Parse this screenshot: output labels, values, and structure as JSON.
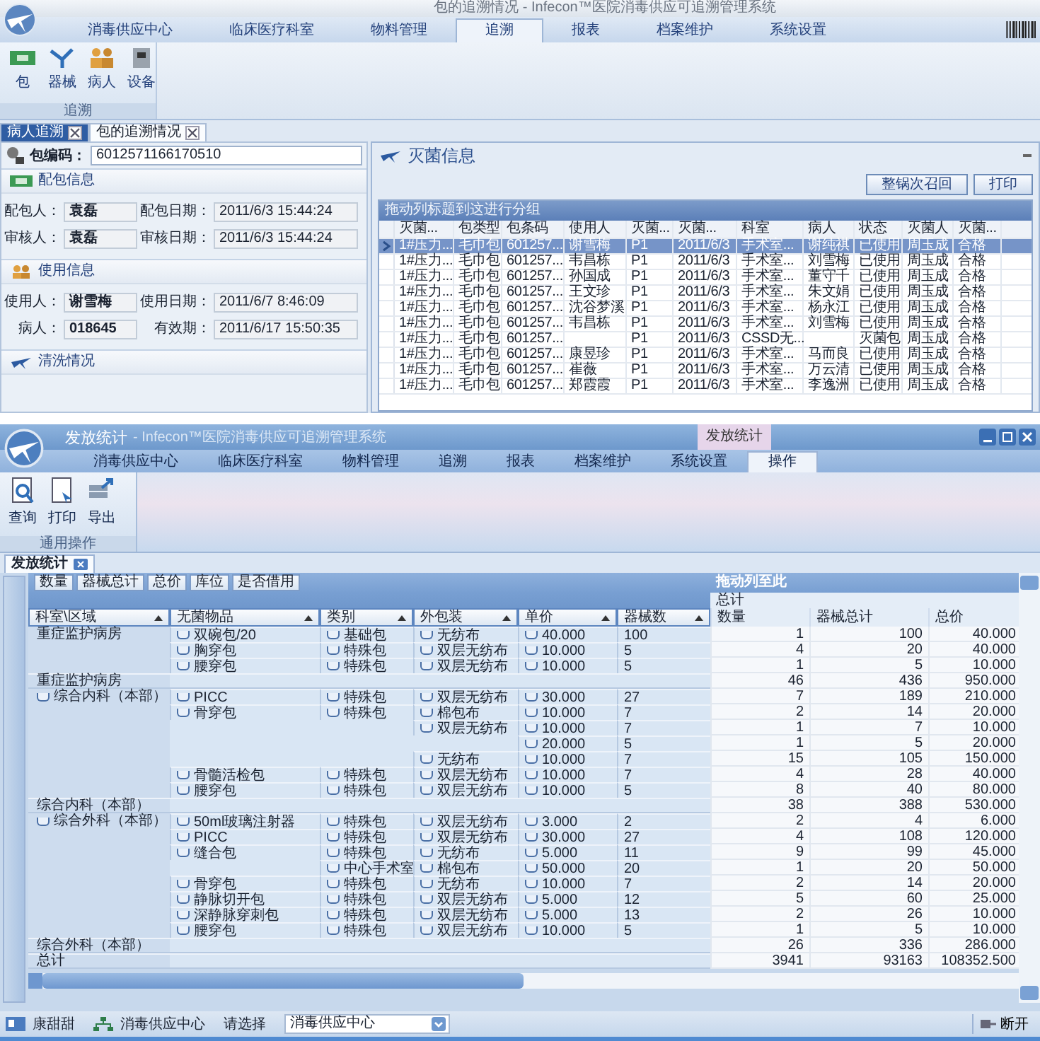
{
  "top_window": {
    "title": "包的追溯情况 - Infecon™医院消毒供应可追溯管理系统",
    "menu": [
      {
        "label": "消毒供应中心",
        "selected": false
      },
      {
        "label": "临床医疗科室",
        "selected": false
      },
      {
        "label": "物料管理",
        "selected": false
      },
      {
        "label": "追溯",
        "selected": true
      },
      {
        "label": "报表",
        "selected": false
      },
      {
        "label": "档案维护",
        "selected": false
      },
      {
        "label": "系统设置",
        "selected": false
      }
    ],
    "ribbon": {
      "buttons": [
        "包",
        "器械",
        "病人",
        "设备"
      ],
      "group": "追溯"
    },
    "doc_tabs": [
      {
        "label": "病人追溯",
        "selected": false,
        "hover": true
      },
      {
        "label": "包的追溯情况",
        "selected": true,
        "hover": false
      }
    ],
    "trace": {
      "code_label": "包编码：",
      "code": "6012571166170510",
      "sections": [
        {
          "title": "配包信息",
          "fields": [
            {
              "label": "配包人：",
              "value": "袁磊"
            },
            {
              "label": "配包日期：",
              "value": "2011/6/3 15:44:24"
            },
            {
              "label": "审核人：",
              "value": "袁磊"
            },
            {
              "label": "审核日期：",
              "value": "2011/6/3 15:44:24"
            }
          ]
        },
        {
          "title": "使用信息",
          "fields": [
            {
              "label": "使用人：",
              "value": "谢雪梅"
            },
            {
              "label": "使用日期：",
              "value": "2011/6/7 8:46:09"
            },
            {
              "label": "病人：",
              "value": "018645"
            },
            {
              "label": "有效期：",
              "value": "2011/6/17 15:50:35"
            }
          ]
        },
        {
          "title": "清洗情况"
        }
      ]
    },
    "sterilization": {
      "title": "灭菌信息",
      "buttons": [
        "整锅次召回",
        "打印"
      ],
      "group_hint": "拖动列标题到这进行分组",
      "columns": [
        "灭菌...",
        "包类型",
        "包条码",
        "使用人",
        "灭菌...",
        "灭菌...",
        "科室",
        "病人",
        "状态",
        "灭菌人",
        "灭菌..."
      ],
      "rows": [
        {
          "selected": true,
          "cells": [
            "1#压力...",
            "毛巾包",
            "601257...",
            "谢雪梅",
            "P1",
            "2011/6/3",
            "手术室...",
            "谢纯祺",
            "已使用",
            "周玉成",
            "合格"
          ]
        },
        {
          "selected": false,
          "cells": [
            "1#压力...",
            "毛巾包",
            "601257...",
            "韦昌栋",
            "P1",
            "2011/6/3",
            "手术室...",
            "刘雪梅",
            "已使用",
            "周玉成",
            "合格"
          ]
        },
        {
          "selected": false,
          "cells": [
            "1#压力...",
            "毛巾包",
            "601257...",
            "孙国成",
            "P1",
            "2011/6/3",
            "手术室...",
            "董守千",
            "已使用",
            "周玉成",
            "合格"
          ]
        },
        {
          "selected": false,
          "cells": [
            "1#压力...",
            "毛巾包",
            "601257...",
            "王文珍",
            "P1",
            "2011/6/3",
            "手术室...",
            "朱文娟",
            "已使用",
            "周玉成",
            "合格"
          ]
        },
        {
          "selected": false,
          "cells": [
            "1#压力...",
            "毛巾包",
            "601257...",
            "沈谷梦溪",
            "P1",
            "2011/6/3",
            "手术室...",
            "杨永江",
            "已使用",
            "周玉成",
            "合格"
          ]
        },
        {
          "selected": false,
          "cells": [
            "1#压力...",
            "毛巾包",
            "601257...",
            "韦昌栋",
            "P1",
            "2011/6/3",
            "手术室...",
            "刘雪梅",
            "已使用",
            "周玉成",
            "合格"
          ]
        },
        {
          "selected": false,
          "cells": [
            "1#压力...",
            "毛巾包",
            "601257...",
            null,
            "P1",
            "2011/6/3",
            "CSSD无...",
            null,
            "灭菌包",
            "周玉成",
            "合格"
          ]
        },
        {
          "selected": false,
          "cells": [
            "1#压力...",
            "毛巾包",
            "601257...",
            "康昱珍",
            "P1",
            "2011/6/3",
            "手术室...",
            "马而良",
            "已使用",
            "周玉成",
            "合格"
          ]
        },
        {
          "selected": false,
          "cells": [
            "1#压力...",
            "毛巾包",
            "601257...",
            "崔薇",
            "P1",
            "2011/6/3",
            "手术室...",
            "万云清",
            "已使用",
            "周玉成",
            "合格"
          ]
        },
        {
          "selected": false,
          "cells": [
            "1#压力...",
            "毛巾包",
            "601257...",
            "郑霞霞",
            "P1",
            "2011/6/3",
            "手术室...",
            "李逸洲",
            "已使用",
            "周玉成",
            "合格"
          ]
        }
      ]
    }
  },
  "bottom_window": {
    "title_doc": "发放统计",
    "title_app": "- Infecon™医院消毒供应可追溯管理系统",
    "context_tab": "发放统计",
    "menu": [
      {
        "label": "消毒供应中心",
        "selected": false
      },
      {
        "label": "临床医疗科室",
        "selected": false
      },
      {
        "label": "物料管理",
        "selected": false
      },
      {
        "label": "追溯",
        "selected": false
      },
      {
        "label": "报表",
        "selected": false
      },
      {
        "label": "档案维护",
        "selected": false
      },
      {
        "label": "系统设置",
        "selected": false
      },
      {
        "label": "操作",
        "selected": true
      }
    ],
    "ribbon": {
      "buttons": [
        "查询",
        "打印",
        "导出"
      ],
      "group": "通用操作"
    },
    "doc_tabs": [
      {
        "label": "发放统计",
        "selected": true
      }
    ],
    "pivot": {
      "filter_fields": [
        "数量",
        "器械总计",
        "总价",
        "库位",
        "是否借用"
      ],
      "drop_hint": "拖动列至此",
      "row_fields": [
        "科室\\区域",
        "无菌物品",
        "类别",
        "外包装",
        "单价",
        "器械数"
      ],
      "data_header": "总计",
      "data_fields": [
        "数量",
        "器械总计",
        "总价"
      ],
      "rows": [
        {
          "kind": "data",
          "area": "重症监护病房",
          "item": "双碗包/20",
          "category": "基础包",
          "pack": "无纺布",
          "price": "40.000",
          "count": "100",
          "values": [
            "1",
            "100",
            "40.000"
          ]
        },
        {
          "kind": "data",
          "item": "胸穿包",
          "category": "特殊包",
          "pack": "双层无纺布",
          "price": "10.000",
          "count": "5",
          "values": [
            "4",
            "20",
            "40.000"
          ]
        },
        {
          "kind": "data",
          "item": "腰穿包",
          "category": "特殊包",
          "pack": "双层无纺布",
          "price": "10.000",
          "count": "5",
          "values": [
            "1",
            "5",
            "10.000"
          ]
        },
        {
          "kind": "subtotal",
          "area": "重症监护病房",
          "values": [
            "46",
            "436",
            "950.000"
          ]
        },
        {
          "kind": "data",
          "area": "综合内科（本部）",
          "area_expanded": true,
          "item": "PICC",
          "category": "特殊包",
          "pack": "双层无纺布",
          "price": "30.000",
          "count": "27",
          "values": [
            "7",
            "189",
            "210.000"
          ]
        },
        {
          "kind": "data",
          "item": "骨穿包",
          "category": "特殊包",
          "pack": "棉包布",
          "price": "10.000",
          "count": "7",
          "values": [
            "2",
            "14",
            "20.000"
          ]
        },
        {
          "kind": "data",
          "pack": "双层无纺布",
          "price": "10.000",
          "count": "7",
          "values": [
            "1",
            "7",
            "10.000"
          ]
        },
        {
          "kind": "data",
          "price": "20.000",
          "count": "5",
          "values": [
            "1",
            "5",
            "20.000"
          ]
        },
        {
          "kind": "data",
          "pack": "无纺布",
          "price": "10.000",
          "count": "7",
          "values": [
            "15",
            "105",
            "150.000"
          ]
        },
        {
          "kind": "data",
          "item": "骨髓活检包",
          "category": "特殊包",
          "pack": "双层无纺布",
          "price": "10.000",
          "count": "7",
          "values": [
            "4",
            "28",
            "40.000"
          ]
        },
        {
          "kind": "data",
          "item": "腰穿包",
          "category": "特殊包",
          "pack": "双层无纺布",
          "price": "10.000",
          "count": "5",
          "values": [
            "8",
            "40",
            "80.000"
          ]
        },
        {
          "kind": "subtotal",
          "area": "综合内科（本部）",
          "values": [
            "38",
            "388",
            "530.000"
          ]
        },
        {
          "kind": "data",
          "area": "综合外科（本部）",
          "area_expanded": true,
          "item": "50ml玻璃注射器",
          "category": "特殊包",
          "pack": "双层无纺布",
          "price": "3.000",
          "count": "2",
          "values": [
            "2",
            "4",
            "6.000"
          ]
        },
        {
          "kind": "data",
          "item": "PICC",
          "category": "特殊包",
          "pack": "双层无纺布",
          "price": "30.000",
          "count": "27",
          "values": [
            "4",
            "108",
            "120.000"
          ]
        },
        {
          "kind": "data",
          "item": "缝合包",
          "category": "特殊包",
          "pack": "无纺布",
          "price": "5.000",
          "count": "11",
          "values": [
            "9",
            "99",
            "45.000"
          ]
        },
        {
          "kind": "data",
          "category": "中心手术室",
          "pack": "棉包布",
          "price": "50.000",
          "count": "20",
          "values": [
            "1",
            "20",
            "50.000"
          ]
        },
        {
          "kind": "data",
          "item": "骨穿包",
          "category": "特殊包",
          "pack": "无纺布",
          "price": "10.000",
          "count": "7",
          "values": [
            "2",
            "14",
            "20.000"
          ]
        },
        {
          "kind": "data",
          "item": "静脉切开包",
          "category": "特殊包",
          "pack": "双层无纺布",
          "price": "5.000",
          "count": "12",
          "values": [
            "5",
            "60",
            "25.000"
          ]
        },
        {
          "kind": "data",
          "item": "深静脉穿刺包",
          "category": "特殊包",
          "pack": "双层无纺布",
          "price": "5.000",
          "count": "13",
          "values": [
            "2",
            "26",
            "10.000"
          ]
        },
        {
          "kind": "data",
          "item": "腰穿包",
          "category": "特殊包",
          "pack": "双层无纺布",
          "price": "10.000",
          "count": "5",
          "values": [
            "1",
            "5",
            "10.000"
          ]
        },
        {
          "kind": "subtotal",
          "area": "综合外科（本部）",
          "values": [
            "26",
            "336",
            "286.000"
          ]
        },
        {
          "kind": "total",
          "area": "总计",
          "values": [
            "3941",
            "93163",
            "108352.500"
          ]
        }
      ]
    },
    "status_bar": {
      "user": "康甜甜",
      "dept": "消毒供应中心",
      "select_label": "请选择",
      "select_value": "消毒供应中心",
      "disconnect": "断开"
    }
  }
}
